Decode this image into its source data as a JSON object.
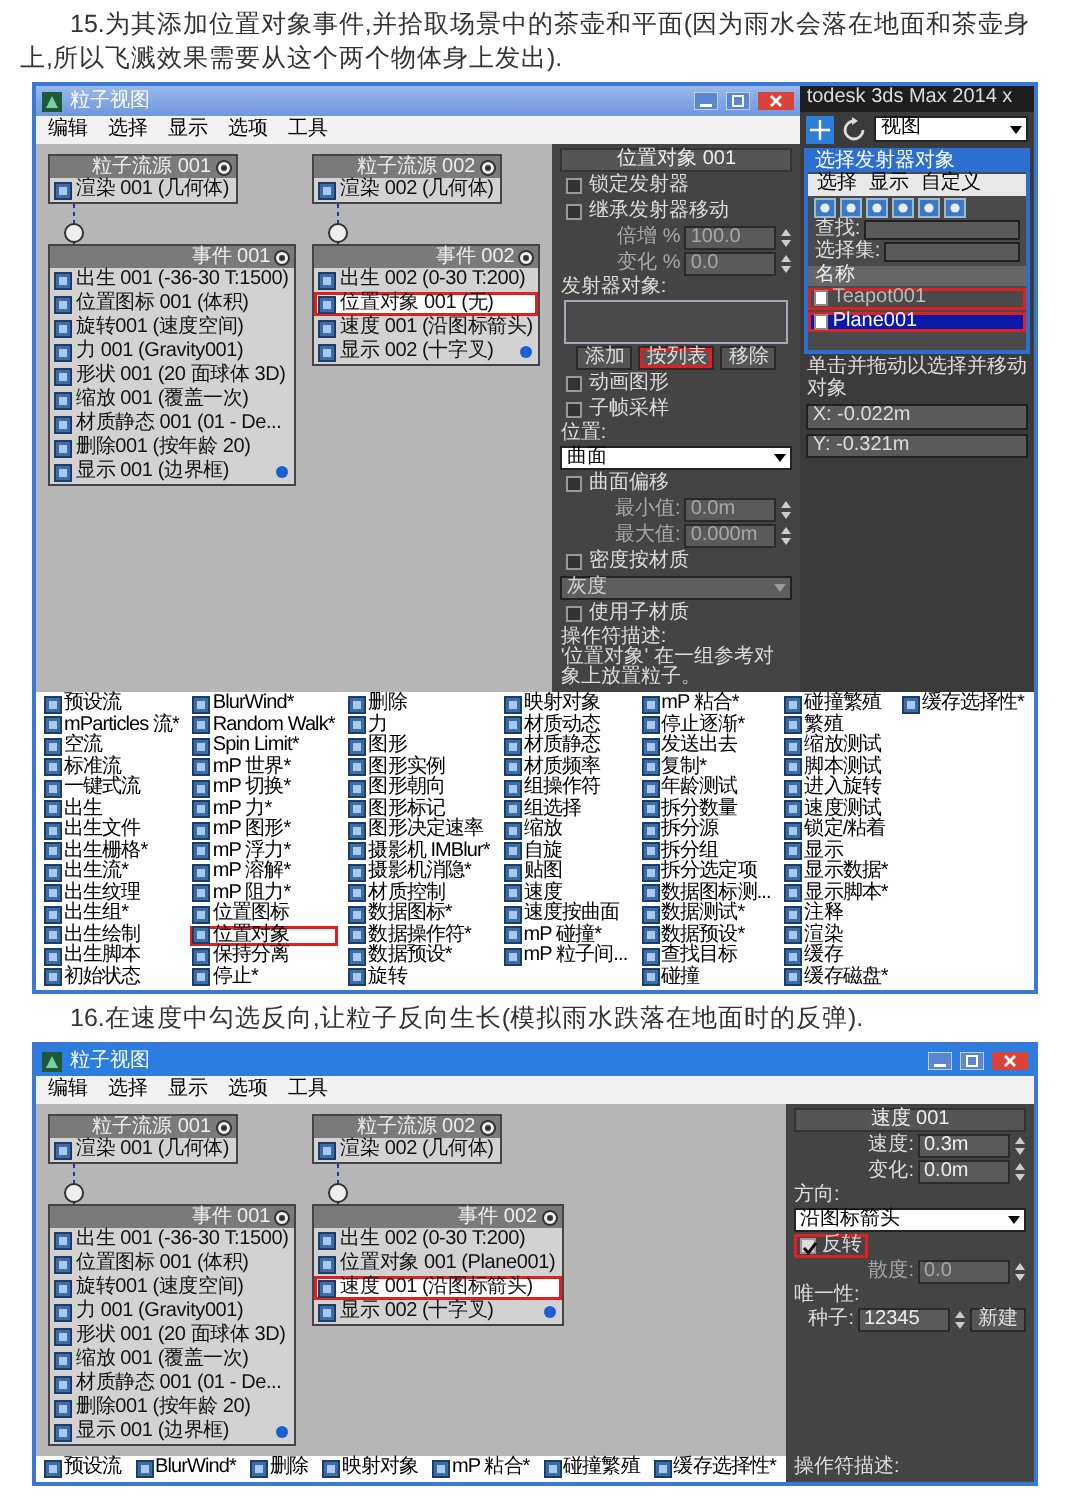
{
  "article": [
    {
      "kind": "paragraph",
      "text": "15.为其添加位置对象事件,并拾取场景中的茶壶和平面(因为雨水会落在地面和茶壶身上,所以飞溅效果需要从这个两个物体身上发出)."
    },
    {
      "kind": "figure",
      "particle_view": {
        "title": "粒子视图",
        "menu": [
          "编辑",
          "选择",
          "显示",
          "选项",
          "工具"
        ],
        "columns": [
          {
            "source": {
              "title": "粒子流源 001",
              "rows": [
                {
                  "text": "渲染 001 (几何体)",
                  "highlighted": false,
                  "dot": false
                }
              ]
            },
            "event": {
              "title": "事件 001",
              "rows": [
                {
                  "text": "出生 001 (-36-30 T:1500)",
                  "highlighted": false,
                  "dot": false
                },
                {
                  "text": "位置图标 001 (体积)",
                  "highlighted": false,
                  "dot": false
                },
                {
                  "text": "旋转001 (速度空间)",
                  "highlighted": false,
                  "dot": false
                },
                {
                  "text": "力 001 (Gravity001)",
                  "highlighted": false,
                  "dot": false
                },
                {
                  "text": "形状 001 (20 面球体 3D)",
                  "highlighted": false,
                  "dot": false
                },
                {
                  "text": "缩放 001 (覆盖一次)",
                  "highlighted": false,
                  "dot": false
                },
                {
                  "text": "材质静态 001 (01 - De...",
                  "highlighted": false,
                  "dot": false
                },
                {
                  "text": "删除001 (按年龄 20)",
                  "highlighted": false,
                  "dot": false
                },
                {
                  "text": "显示 001 (边界框)",
                  "highlighted": false,
                  "dot": true
                }
              ]
            }
          },
          {
            "source": {
              "title": "粒子流源 002",
              "rows": [
                {
                  "text": "渲染 002 (几何体)",
                  "highlighted": false,
                  "dot": false
                }
              ]
            },
            "event": {
              "title": "事件 002",
              "rows": [
                {
                  "text": "出生 002 (0-30 T:200)",
                  "highlighted": false,
                  "dot": false
                },
                {
                  "text": "位置对象 001 (无)",
                  "highlighted": true,
                  "dot": false
                },
                {
                  "text": "速度 001 (沿图标箭头)",
                  "highlighted": false,
                  "dot": false
                },
                {
                  "text": "显示 002 (十字叉)",
                  "highlighted": false,
                  "dot": true
                }
              ]
            }
          }
        ],
        "panel": [
          {
            "kind": "title",
            "text": "位置对象 001"
          },
          {
            "kind": "checkbox",
            "label": "锁定发射器",
            "checked": false,
            "highlighted": false
          },
          {
            "kind": "checkbox",
            "label": "继承发射器移动",
            "checked": false,
            "highlighted": false
          },
          {
            "kind": "spinner",
            "label": "倍增 %",
            "value": "100.0",
            "disabled": true
          },
          {
            "kind": "spinner",
            "label": "变化 %",
            "value": "0.0",
            "disabled": true
          },
          {
            "kind": "group",
            "label": "发射器对象:"
          },
          {
            "kind": "listbox"
          },
          {
            "kind": "buttons",
            "buttons": [
              {
                "label": "添加",
                "highlighted": false
              },
              {
                "label": "按列表",
                "highlighted": true
              },
              {
                "label": "移除",
                "highlighted": false
              }
            ]
          },
          {
            "kind": "checkbox",
            "label": "动画图形",
            "checked": false,
            "highlighted": false
          },
          {
            "kind": "checkbox",
            "label": "子帧采样",
            "checked": false,
            "highlighted": false
          },
          {
            "kind": "group",
            "label": "位置:"
          },
          {
            "kind": "dropdown",
            "value": "曲面",
            "disabled": false
          },
          {
            "kind": "checkbox",
            "label": "曲面偏移",
            "checked": false,
            "highlighted": false
          },
          {
            "kind": "spinner",
            "label": "最小值:",
            "value": "0.0m",
            "disabled": true
          },
          {
            "kind": "spinner",
            "label": "最大值:",
            "value": "0.000m",
            "disabled": true
          },
          {
            "kind": "checkbox",
            "label": "密度按材质",
            "checked": false,
            "highlighted": false
          },
          {
            "kind": "dropdown",
            "value": "灰度",
            "disabled": true
          },
          {
            "kind": "checkbox",
            "label": "使用子材质",
            "checked": false,
            "highlighted": false
          },
          {
            "kind": "note",
            "label": "操作符描述:",
            "text": "'位置对象' 在一组参考对象上放置粒子。"
          }
        ],
        "depot": {
          "columns": [
            [
              {
                "text": "预设流",
                "highlighted": false
              },
              {
                "text": "mParticles 流*",
                "highlighted": false
              },
              {
                "text": "空流",
                "highlighted": false
              },
              {
                "text": "标准流",
                "highlighted": false
              },
              {
                "text": "一键式流",
                "highlighted": false
              },
              {
                "text": "出生",
                "highlighted": false
              },
              {
                "text": "出生文件",
                "highlighted": false
              },
              {
                "text": "出生栅格*",
                "highlighted": false
              },
              {
                "text": "出生流*",
                "highlighted": false
              },
              {
                "text": "出生纹理",
                "highlighted": false
              },
              {
                "text": "出生组*",
                "highlighted": false
              },
              {
                "text": "出生绘制",
                "highlighted": false
              },
              {
                "text": "出生脚本",
                "highlighted": false
              },
              {
                "text": "初始状态",
                "highlighted": false
              }
            ],
            [
              {
                "text": "BlurWind*",
                "highlighted": false
              },
              {
                "text": "Random Walk*",
                "highlighted": false
              },
              {
                "text": "Spin Limit*",
                "highlighted": false
              },
              {
                "text": "mP 世界*",
                "highlighted": false
              },
              {
                "text": "mP 切换*",
                "highlighted": false
              },
              {
                "text": "mP 力*",
                "highlighted": false
              },
              {
                "text": "mP 图形*",
                "highlighted": false
              },
              {
                "text": "mP 浮力*",
                "highlighted": false
              },
              {
                "text": "mP 溶解*",
                "highlighted": false
              },
              {
                "text": "mP 阻力*",
                "highlighted": false
              },
              {
                "text": "位置图标",
                "highlighted": false
              },
              {
                "text": "位置对象",
                "highlighted": true
              },
              {
                "text": "保持分离",
                "highlighted": false
              },
              {
                "text": "停止*",
                "highlighted": false
              }
            ],
            [
              {
                "text": "删除",
                "highlighted": false
              },
              {
                "text": "力",
                "highlighted": false
              },
              {
                "text": "图形",
                "highlighted": false
              },
              {
                "text": "图形实例",
                "highlighted": false
              },
              {
                "text": "图形朝向",
                "highlighted": false
              },
              {
                "text": "图形标记",
                "highlighted": false
              },
              {
                "text": "图形决定速率",
                "highlighted": false
              },
              {
                "text": "摄影机 IMBlur*",
                "highlighted": false
              },
              {
                "text": "摄影机消隐*",
                "highlighted": false
              },
              {
                "text": "材质控制",
                "highlighted": false
              },
              {
                "text": "数据图标*",
                "highlighted": false
              },
              {
                "text": "数据操作符*",
                "highlighted": false
              },
              {
                "text": "数据预设*",
                "highlighted": false
              },
              {
                "text": "旋转",
                "highlighted": false
              }
            ],
            [
              {
                "text": "映射对象",
                "highlighted": false
              },
              {
                "text": "材质动态",
                "highlighted": false
              },
              {
                "text": "材质静态",
                "highlighted": false
              },
              {
                "text": "材质频率",
                "highlighted": false
              },
              {
                "text": "组操作符",
                "highlighted": false
              },
              {
                "text": "组选择",
                "highlighted": false
              },
              {
                "text": "缩放",
                "highlighted": false
              },
              {
                "text": "自旋",
                "highlighted": false
              },
              {
                "text": "贴图",
                "highlighted": false
              },
              {
                "text": "速度",
                "highlighted": false
              },
              {
                "text": "速度按曲面",
                "highlighted": false
              },
              {
                "text": "mP 碰撞*",
                "highlighted": false
              },
              {
                "text": "mP 粒子间...",
                "highlighted": false
              }
            ],
            [
              {
                "text": "mP 粘合*",
                "highlighted": false
              },
              {
                "text": "停止逐渐*",
                "highlighted": false
              },
              {
                "text": "发送出去",
                "highlighted": false
              },
              {
                "text": "复制*",
                "highlighted": false
              },
              {
                "text": "年龄测试",
                "highlighted": false
              },
              {
                "text": "拆分数量",
                "highlighted": false
              },
              {
                "text": "拆分源",
                "highlighted": false
              },
              {
                "text": "拆分组",
                "highlighted": false
              },
              {
                "text": "拆分选定项",
                "highlighted": false
              },
              {
                "text": "数据图标测...",
                "highlighted": false
              },
              {
                "text": "数据测试*",
                "highlighted": false
              },
              {
                "text": "数据预设*",
                "highlighted": false
              },
              {
                "text": "查找目标",
                "highlighted": false
              },
              {
                "text": "碰撞",
                "highlighted": false
              }
            ],
            [
              {
                "text": "碰撞繁殖",
                "highlighted": false
              },
              {
                "text": "繁殖",
                "highlighted": false
              },
              {
                "text": "缩放测试",
                "highlighted": false
              },
              {
                "text": "脚本测试",
                "highlighted": false
              },
              {
                "text": "进入旋转",
                "highlighted": false
              },
              {
                "text": "速度测试",
                "highlighted": false
              },
              {
                "text": "锁定/粘着",
                "highlighted": false
              },
              {
                "text": "显示",
                "highlighted": false
              },
              {
                "text": "显示数据*",
                "highlighted": false
              },
              {
                "text": "显示脚本*",
                "highlighted": false
              },
              {
                "text": "注释",
                "highlighted": false
              },
              {
                "text": "渲染",
                "highlighted": false
              },
              {
                "text": "缓存",
                "highlighted": false
              },
              {
                "text": "缓存磁盘*",
                "highlighted": false
              }
            ],
            [
              {
                "text": "缓存选择性*",
                "highlighted": false
              }
            ]
          ]
        }
      },
      "max_window": {
        "title": "todesk 3ds Max 2014 x",
        "view_dropdown": "视图",
        "dialog": {
          "title": "选择发射器对象",
          "menu": [
            "选择",
            "显示",
            "自定义"
          ],
          "find_label": "查找:",
          "set_label": "选择集:",
          "column": "名称",
          "items": [
            {
              "text": "Teapot001",
              "selected": false,
              "highlighted": true
            },
            {
              "text": "Plane001",
              "selected": true,
              "highlighted": true
            }
          ]
        },
        "status": "单击并拖动以选择并移动对象",
        "coords": [
          "X: -0.022m",
          "Y: -0.321m"
        ]
      }
    },
    {
      "kind": "paragraph",
      "text": "16.在速度中勾选反向,让粒子反向生长(模拟雨水跌落在地面时的反弹)."
    },
    {
      "kind": "figure",
      "particle_view": {
        "title": "粒子视图",
        "menu": [
          "编辑",
          "选择",
          "显示",
          "选项",
          "工具"
        ],
        "columns": [
          {
            "source": {
              "title": "粒子流源 001",
              "rows": [
                {
                  "text": "渲染 001 (几何体)",
                  "highlighted": false,
                  "dot": false
                }
              ]
            },
            "event": {
              "title": "事件 001",
              "rows": [
                {
                  "text": "出生 001 (-36-30 T:1500)",
                  "highlighted": false,
                  "dot": false
                },
                {
                  "text": "位置图标 001 (体积)",
                  "highlighted": false,
                  "dot": false
                },
                {
                  "text": "旋转001 (速度空间)",
                  "highlighted": false,
                  "dot": false
                },
                {
                  "text": "力 001 (Gravity001)",
                  "highlighted": false,
                  "dot": false
                },
                {
                  "text": "形状 001 (20 面球体 3D)",
                  "highlighted": false,
                  "dot": false
                },
                {
                  "text": "缩放 001 (覆盖一次)",
                  "highlighted": false,
                  "dot": false
                },
                {
                  "text": "材质静态 001 (01 - De...",
                  "highlighted": false,
                  "dot": false
                },
                {
                  "text": "删除001 (按年龄 20)",
                  "highlighted": false,
                  "dot": false
                },
                {
                  "text": "显示 001 (边界框)",
                  "highlighted": false,
                  "dot": true
                }
              ]
            }
          },
          {
            "source": {
              "title": "粒子流源 002",
              "rows": [
                {
                  "text": "渲染 002 (几何体)",
                  "highlighted": false,
                  "dot": false
                }
              ]
            },
            "event": {
              "title": "事件 002",
              "rows": [
                {
                  "text": "出生 002 (0-30 T:200)",
                  "highlighted": false,
                  "dot": false
                },
                {
                  "text": "位置对象 001 (Plane001)",
                  "highlighted": false,
                  "dot": false
                },
                {
                  "text": "速度 001 (沿图标箭头)",
                  "highlighted": true,
                  "dot": false
                },
                {
                  "text": "显示 002 (十字叉)",
                  "highlighted": false,
                  "dot": true
                }
              ]
            }
          }
        ],
        "panel": [
          {
            "kind": "title",
            "text": "速度 001"
          },
          {
            "kind": "spinner",
            "label": "速度:",
            "value": "0.3m",
            "disabled": false
          },
          {
            "kind": "spinner",
            "label": "变化:",
            "value": "0.0m",
            "disabled": false
          },
          {
            "kind": "group",
            "label": "方向:"
          },
          {
            "kind": "dropdown",
            "value": "沿图标箭头",
            "disabled": false
          },
          {
            "kind": "checkbox",
            "label": "反转",
            "checked": true,
            "highlighted": true
          },
          {
            "kind": "spinner",
            "label": "散度:",
            "value": "0.0",
            "disabled": true
          },
          {
            "kind": "group",
            "label": "唯一性:"
          },
          {
            "kind": "seed",
            "label": "种子:",
            "value": "12345",
            "button": "新建"
          }
        ],
        "depot": {
          "columns": [
            [
              {
                "text": "预设流",
                "highlighted": false
              }
            ],
            [
              {
                "text": "BlurWind*",
                "highlighted": false
              }
            ],
            [
              {
                "text": "删除",
                "highlighted": false
              }
            ],
            [
              {
                "text": "映射对象",
                "highlighted": false
              }
            ],
            [
              {
                "text": "mP 粘合*",
                "highlighted": false
              }
            ],
            [
              {
                "text": "碰撞繁殖",
                "highlighted": false
              }
            ],
            [
              {
                "text": "缓存选择性*",
                "highlighted": false
              }
            ]
          ]
        },
        "depot_note": {
          "label": "操作符描述:"
        }
      }
    }
  ]
}
